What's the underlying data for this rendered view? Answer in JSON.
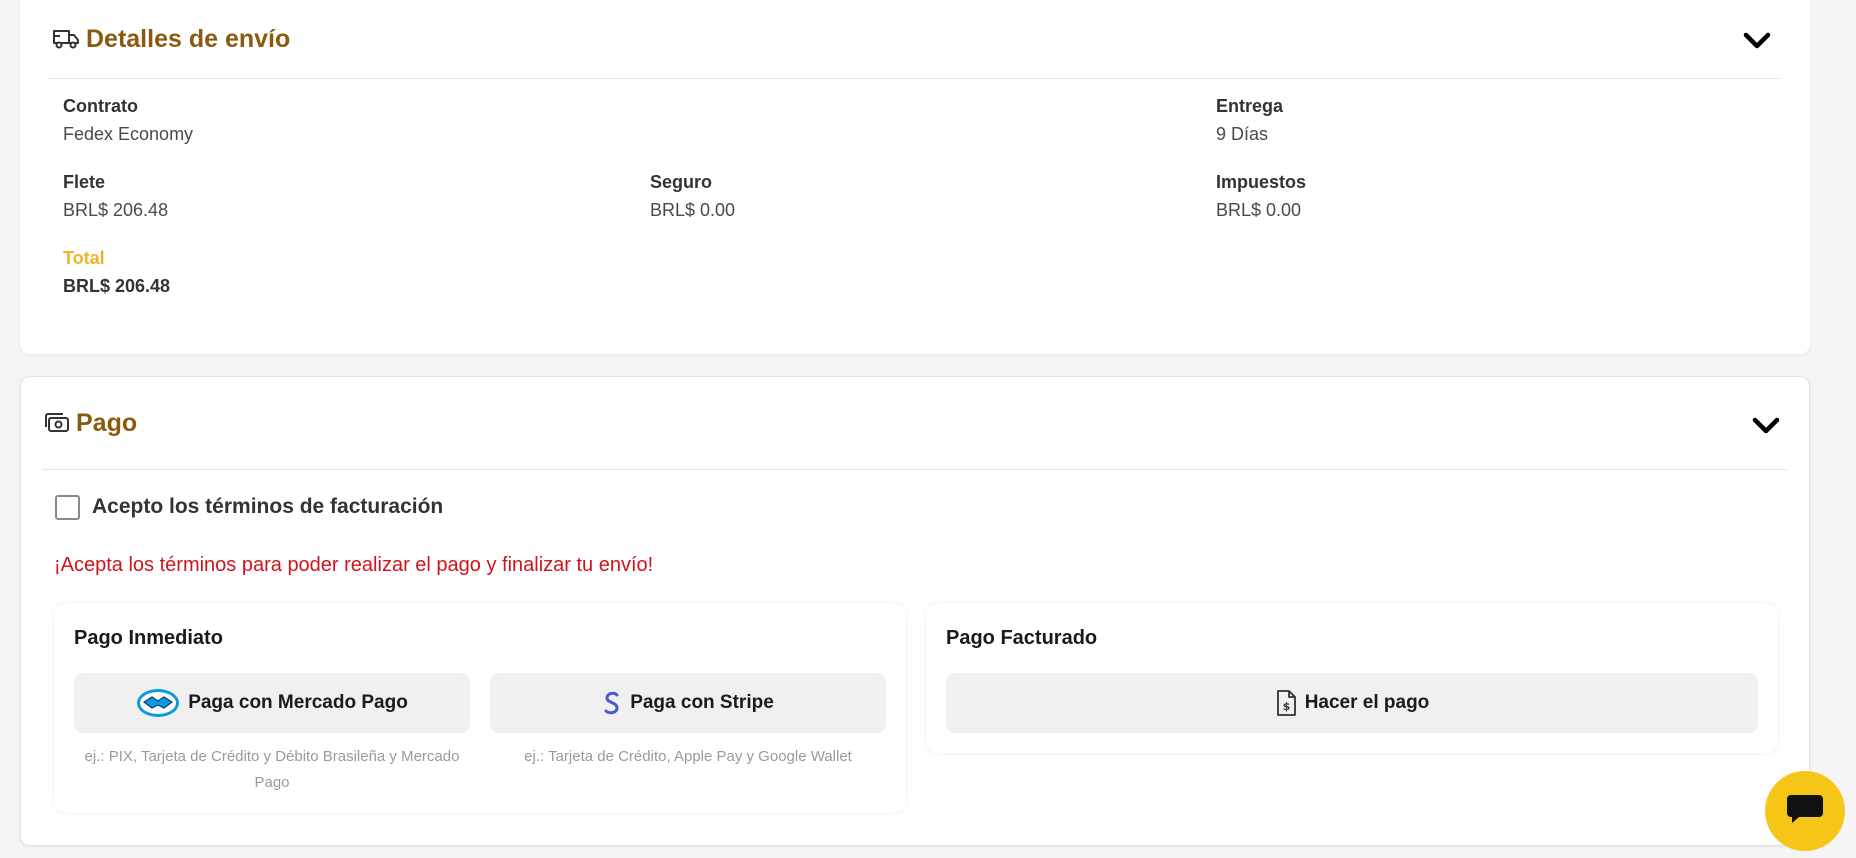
{
  "shipping": {
    "title": "Detalles de envío",
    "icon": "truck-icon",
    "contract_label": "Contrato",
    "contract_value": "Fedex Economy",
    "delivery_label": "Entrega",
    "delivery_value": "9 Días",
    "freight_label": "Flete",
    "freight_value": "BRL$ 206.48",
    "insurance_label": "Seguro",
    "insurance_value": "BRL$ 0.00",
    "taxes_label": "Impuestos",
    "taxes_value": "BRL$ 0.00",
    "total_label": "Total",
    "total_value": "BRL$ 206.48"
  },
  "payment": {
    "title": "Pago",
    "icon": "money-icon",
    "terms_label": "Acepto los términos de facturación",
    "terms_checked": false,
    "warning": "¡Acepta los términos para poder realizar el pago y finalizar tu envío!",
    "immediate": {
      "title": "Pago Inmediato",
      "mercado_label": "Paga con Mercado Pago",
      "mercado_hint": "ej.: PIX, Tarjeta de Crédito y Débito Brasileña y Mercado Pago",
      "stripe_label": "Paga con Stripe",
      "stripe_hint": "ej.: Tarjeta de Crédito, Apple Pay y Google Wallet"
    },
    "invoiced": {
      "title": "Pago Facturado",
      "button_label": "Hacer el pago"
    }
  },
  "colors": {
    "title": "#8a5a0e",
    "total": "#f0b429",
    "warning": "#d0141c",
    "chat": "#f5c518"
  }
}
